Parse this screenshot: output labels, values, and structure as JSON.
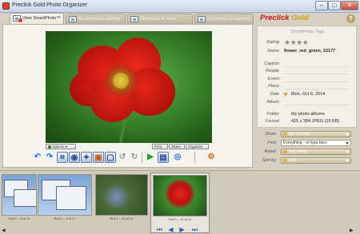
{
  "window": {
    "title": "Preclick Gold Photo Organizer",
    "minimize": "–",
    "maximize": "□",
    "close": "✕"
  },
  "tabs": [
    {
      "label": "View SmartPhoto™"
    },
    {
      "label": "No photos for printing"
    },
    {
      "label": "No photos to share"
    },
    {
      "label": "No photos to organize"
    }
  ],
  "brand": {
    "part1": "Preclick",
    "part2": "Gold"
  },
  "help": "?",
  "viewer": {
    "options_label": "Options",
    "print_label": "Print",
    "share_label": "Share",
    "organize_label": "Organize"
  },
  "toolbar_icons": [
    "rotate-left-icon",
    "rotate-right-icon",
    "crop-icon",
    "red-eye-icon",
    "enhance-icon",
    "color-icon",
    "frame-icon",
    "undo-icon",
    "redo-icon",
    "play-icon",
    "slideshow-icon",
    "lens-icon",
    "settings-icon"
  ],
  "smartphoto": {
    "title": "SmartPhoto Tags",
    "rating_label": "Rating",
    "rating_stars": "★★★★",
    "name_label": "Name",
    "name_value": "flower_red_green_22177",
    "caption_label": "Caption",
    "people_label": "People",
    "event_label": "Event",
    "place_label": "Place",
    "date_label": "Date",
    "date_value": "Mon, Oct 6, 2014",
    "album_label": "Album",
    "folder_label": "Folder",
    "folder_value": "My photo albums",
    "format_label": "Format",
    "format_value": "425 x 284 JPEG (16 KB)"
  },
  "filters": {
    "show_label": "Show",
    "show_value": "My Pictures",
    "find_label": "Find",
    "find_placeholder": "Everything - or type here",
    "rated_label": "Rated",
    "rated_value": "Any rating",
    "sort_label": "Sort by",
    "sort_value": "Roll"
  },
  "filmstrip": {
    "items": [
      {
        "caption": "Roll 1 – 8 of 11"
      },
      {
        "caption": "Roll 1 – 9 of 11"
      },
      {
        "caption": "Roll 1 – 10 of 11"
      },
      {
        "caption": "Roll 1 – 11 of 11"
      }
    ]
  },
  "colors": {
    "brand_red": "#c81818",
    "brand_gold": "#d8a018",
    "panel_bg": "#f1efe7"
  }
}
